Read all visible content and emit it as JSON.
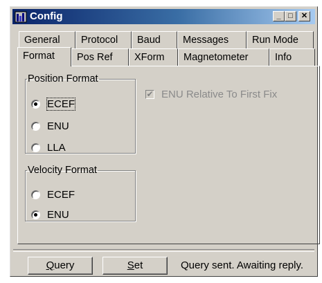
{
  "window": {
    "title": "Config",
    "controls": {
      "minimize": "_",
      "maximize": "□",
      "close": "✕"
    },
    "icon": "app-icon"
  },
  "tabs": {
    "row1": [
      "General",
      "Protocol",
      "Baud",
      "Messages",
      "Run Mode"
    ],
    "row2": [
      "Format",
      "Pos Ref",
      "XForm",
      "Magnetometer",
      "Info"
    ],
    "active": "Format"
  },
  "position_format": {
    "title": "Position Format",
    "options": [
      "ECEF",
      "ENU",
      "LLA"
    ],
    "selected": "ECEF"
  },
  "velocity_format": {
    "title": "Velocity Format",
    "options": [
      "ECEF",
      "ENU"
    ],
    "selected": "ENU"
  },
  "enu_relative": {
    "label": "ENU Relative To First Fix",
    "checked": true,
    "enabled": false
  },
  "buttons": {
    "query": {
      "accel": "Q",
      "rest": "uery"
    },
    "set": {
      "accel": "S",
      "rest": "et"
    }
  },
  "status": "Query sent. Awaiting reply."
}
